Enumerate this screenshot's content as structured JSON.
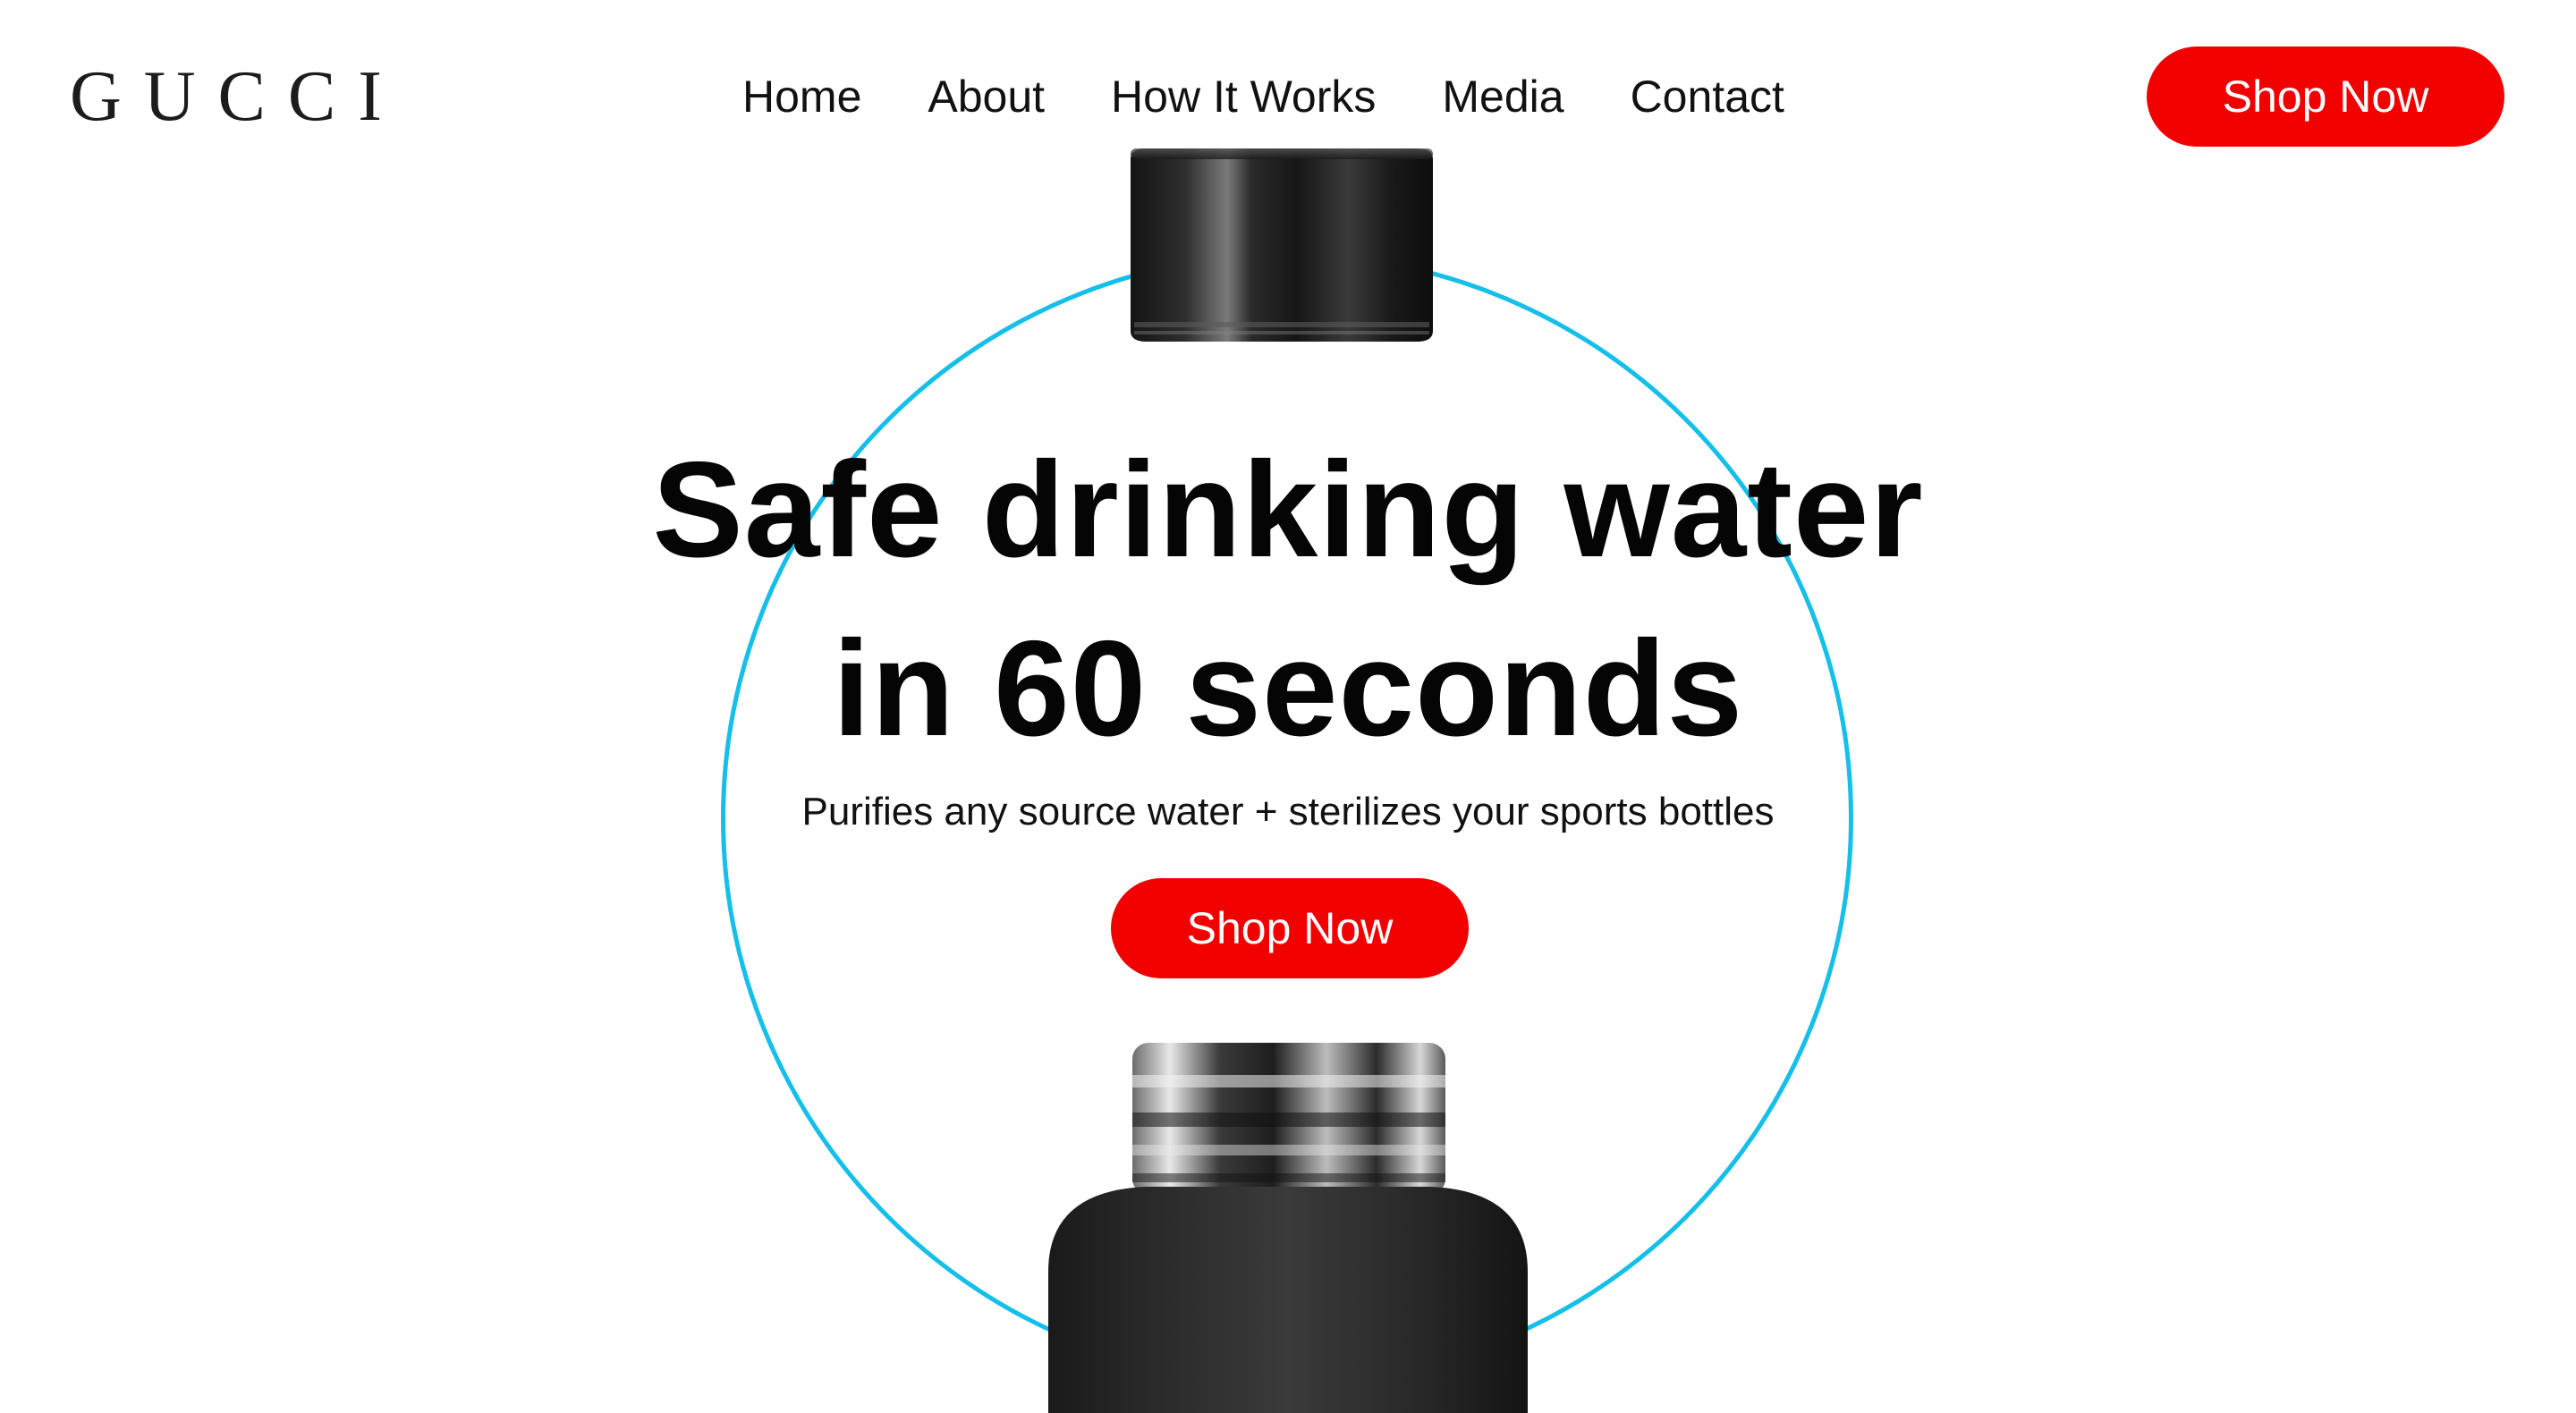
{
  "header": {
    "logo_text": "GUCCI",
    "nav": [
      {
        "label": "Home"
      },
      {
        "label": "About"
      },
      {
        "label": "How It Works"
      },
      {
        "label": "Media"
      },
      {
        "label": "Contact"
      }
    ],
    "cta_label": "Shop Now"
  },
  "hero": {
    "headline_line1": "Safe drinking water",
    "headline_line2": "in 60 seconds",
    "subheadline": "Purifies any source water + sterilizes your sports bottles",
    "cta_label": "Shop Now"
  },
  "colors": {
    "accent_red": "#f20000",
    "ring_blue": "#15bfea",
    "text_dark": "#0b0b0b"
  },
  "icons": {
    "cap": "bottle-cap-image",
    "bottle": "bottle-body-image"
  }
}
